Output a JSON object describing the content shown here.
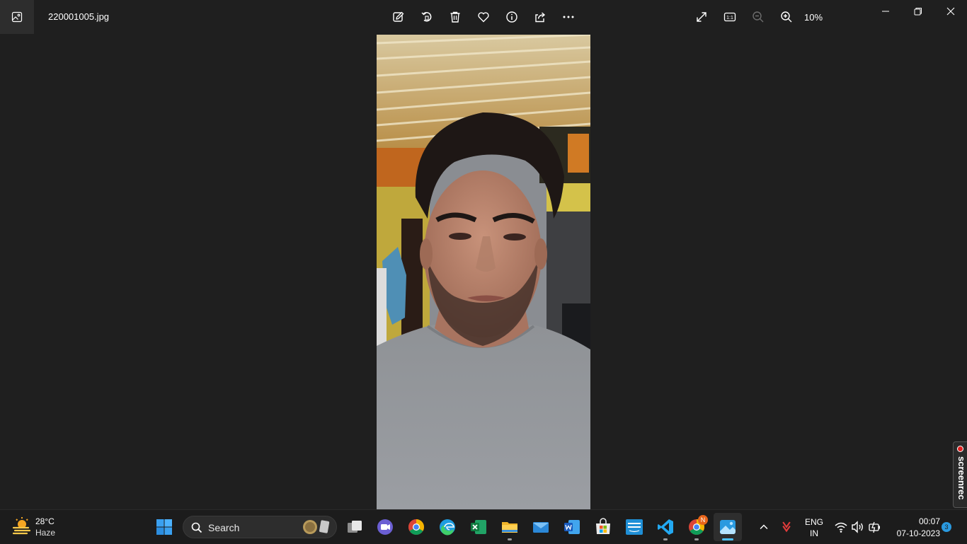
{
  "window": {
    "filename": "220001005.jpg",
    "zoom_level": "10%"
  },
  "toolbar": {
    "icons": [
      "edit-icon",
      "rotate-icon",
      "delete-icon",
      "favorite-icon",
      "info-icon",
      "share-icon",
      "more-icon"
    ],
    "view_icons": [
      "fullscreen-icon",
      "actual-size-icon",
      "zoom-out-icon",
      "zoom-in-icon"
    ],
    "actual_size_label": "1:1"
  },
  "screenrec": {
    "label": "screenrec"
  },
  "taskbar": {
    "weather": {
      "temp": "28°C",
      "condition": "Haze"
    },
    "search": {
      "placeholder": "Search"
    },
    "apps": [
      "start",
      "task-view",
      "teams-meet",
      "chrome",
      "edge",
      "excel",
      "file-explorer",
      "mail",
      "word",
      "microsoft-store",
      "prime-video",
      "vscode",
      "chrome-profile",
      "photos"
    ],
    "chrome_profile_badge": "N",
    "tray": {
      "language": "ENG",
      "region": "IN",
      "time": "00:07",
      "date": "07-10-2023",
      "notification_count": "3"
    }
  },
  "colors": {
    "background": "#1f1f1f",
    "taskbar": "#1c1c1c",
    "accent": "#4cc2ff"
  }
}
